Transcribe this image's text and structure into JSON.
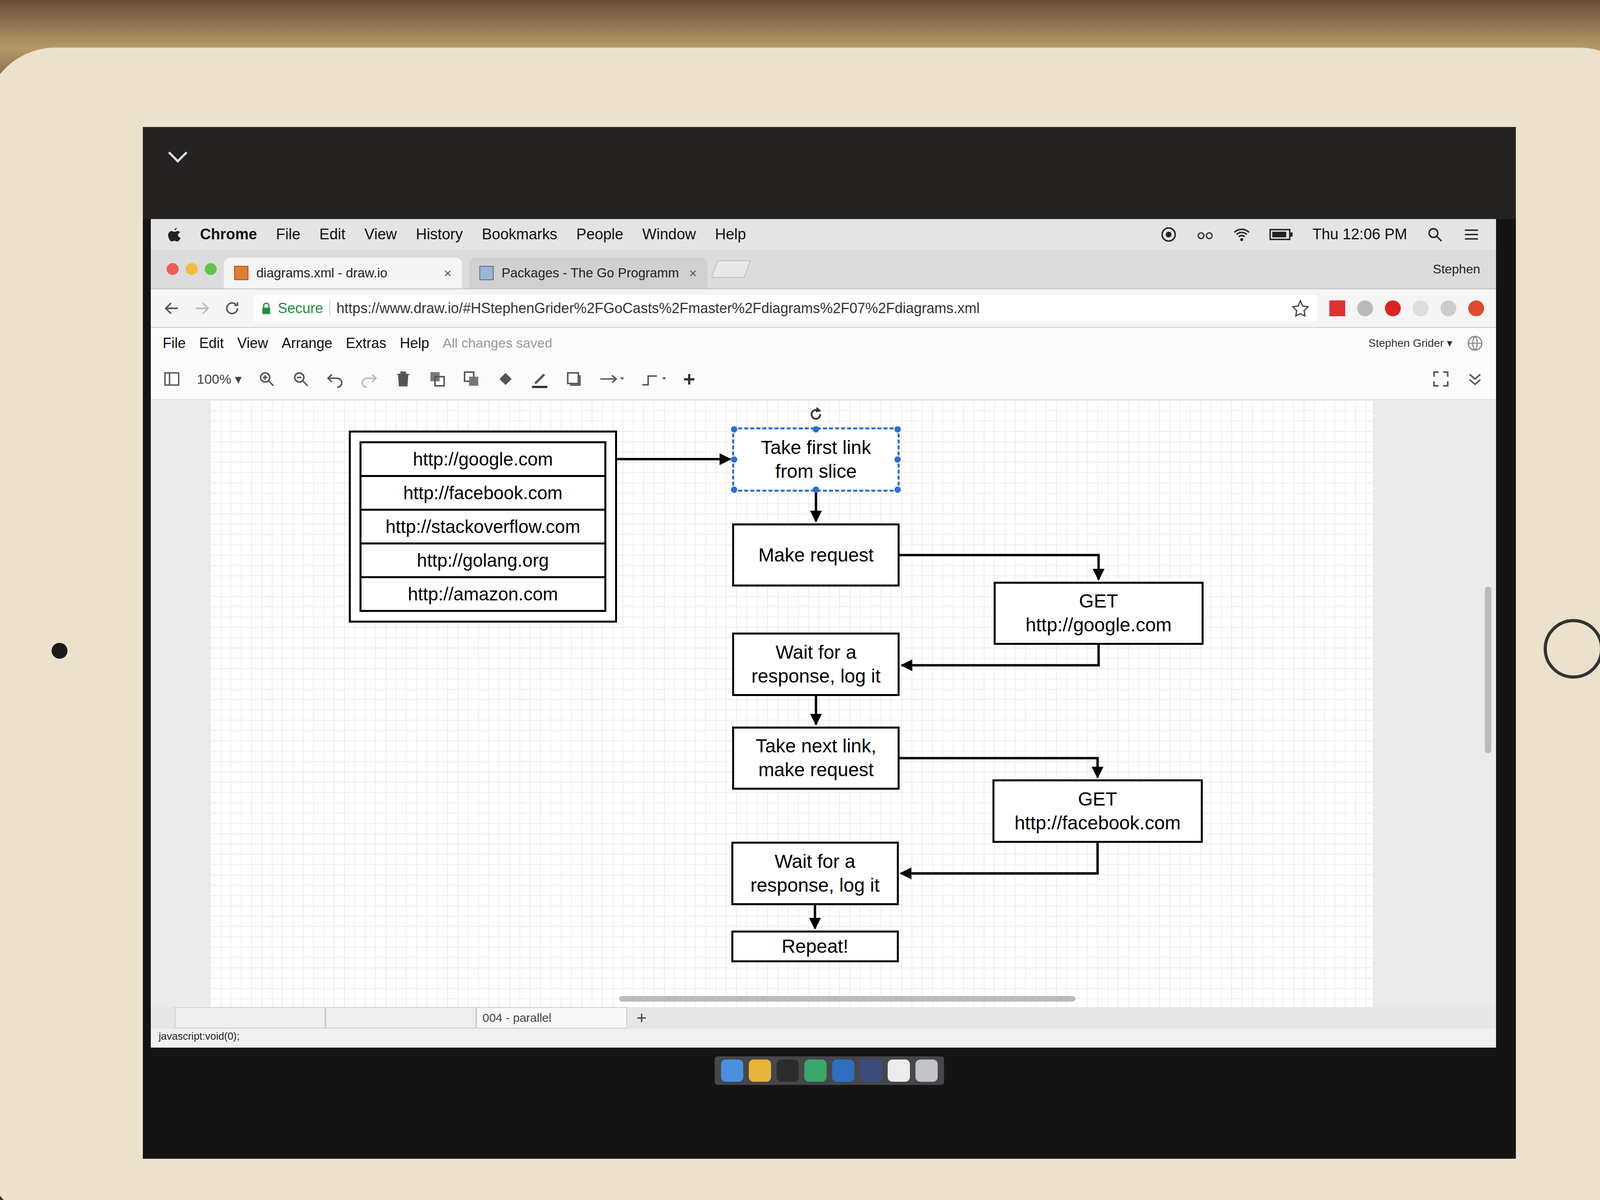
{
  "menu_bar": {
    "app": "Chrome",
    "items": [
      "File",
      "Edit",
      "View",
      "History",
      "Bookmarks",
      "People",
      "Window",
      "Help"
    ],
    "clock": "Thu 12:06 PM"
  },
  "tabs": [
    {
      "label": "diagrams.xml - draw.io",
      "selected": true,
      "close": "×"
    },
    {
      "label": "Packages - The Go Programm",
      "selected": false,
      "close": "×"
    }
  ],
  "profile": "Stephen",
  "address": {
    "secure": "Secure",
    "url": "https://www.draw.io/#HStephenGrider%2FGoCasts%2Fmaster%2Fdiagrams%2F07%2Fdiagrams.xml"
  },
  "app_menu": {
    "items": [
      "File",
      "Edit",
      "View",
      "Arrange",
      "Extras",
      "Help"
    ],
    "status": "All changes saved",
    "user": "Stephen Grider"
  },
  "toolbar": {
    "zoom": "100%",
    "insert": "+"
  },
  "diagram": {
    "slice": [
      "http://google.com",
      "http://facebook.com",
      "http://stackoverflow.com",
      "http://golang.org",
      "http://amazon.com"
    ],
    "nodes": [
      {
        "lines": [
          "Take first link",
          "from slice"
        ],
        "selected": true
      },
      {
        "lines": [
          "Make request"
        ],
        "selected": false
      },
      {
        "lines": [
          "GET",
          "http://google.com"
        ],
        "selected": false
      },
      {
        "lines": [
          "Wait for a",
          "response, log it"
        ],
        "selected": false
      },
      {
        "lines": [
          "Take next link,",
          "make request"
        ],
        "selected": false
      },
      {
        "lines": [
          "GET",
          "http://facebook.com"
        ],
        "selected": false
      },
      {
        "lines": [
          "Wait for a",
          "response, log it"
        ],
        "selected": false
      },
      {
        "lines": [
          "Repeat!"
        ],
        "selected": false
      }
    ]
  },
  "page_tabs": [
    {
      "label": "004 - parallel",
      "selected": true
    }
  ],
  "add_page": "+",
  "status": "javascript:void(0);"
}
